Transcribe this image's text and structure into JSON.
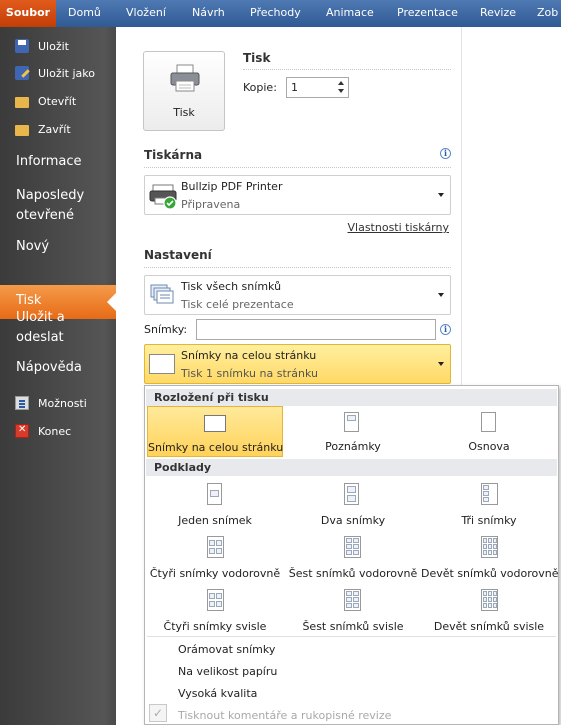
{
  "ribbon": {
    "tabs": [
      "Soubor",
      "Domů",
      "Vložení",
      "Návrh",
      "Přechody",
      "Animace",
      "Prezentace",
      "Revize",
      "Zob"
    ]
  },
  "nav": {
    "save": "Uložit",
    "save_as": "Uložit jako",
    "open": "Otevřít",
    "close": "Zavřít",
    "info": "Informace",
    "recent_1": "Naposledy",
    "recent_2": "otevřené",
    "new": "Nový",
    "print": "Tisk",
    "share_1": "Uložit a",
    "share_2": "odeslat",
    "help": "Nápověda",
    "options": "Možnosti",
    "exit": "Konec"
  },
  "print": {
    "heading": "Tisk",
    "button_label": "Tisk",
    "copies_label": "Kopie:",
    "copies_value": "1"
  },
  "printer": {
    "heading": "Tiskárna",
    "name": "Bullzip PDF Printer",
    "status": "Připravena",
    "properties_link": "Vlastnosti tiskárny"
  },
  "settings": {
    "heading": "Nastavení",
    "slides_combo_title": "Tisk všech snímků",
    "slides_combo_desc": "Tisk celé prezentace",
    "slides_label": "Snímky:",
    "slides_value": "",
    "layout_combo_title": "Snímky na celou stránku",
    "layout_combo_desc": "Tisk 1 snímku na stránku"
  },
  "gallery": {
    "layout_heading": "Rozložení při tisku",
    "layout_items": [
      "Snímky na celou stránku",
      "Poznámky",
      "Osnova"
    ],
    "handouts_heading": "Podklady",
    "handout_items": [
      "Jeden snímek",
      "Dva snímky",
      "Tři snímky",
      "Čtyři snímky vodorovně",
      "Šest snímků vodorovně",
      "Devět snímků vodorovně",
      "Čtyři snímky svisle",
      "Šest snímků svisle",
      "Devět snímků svisle"
    ],
    "options": [
      "Orámovat snímky",
      "Na velikost papíru",
      "Vysoká kvalita",
      "Tisknout komentáře a rukopisné revize"
    ],
    "checkmark": "✓"
  },
  "colors": {
    "file_tab": "#d2480c",
    "ribbon": "#3a659f",
    "nav_active": "#ec7a26",
    "selected_item": "#ffdb6b"
  }
}
